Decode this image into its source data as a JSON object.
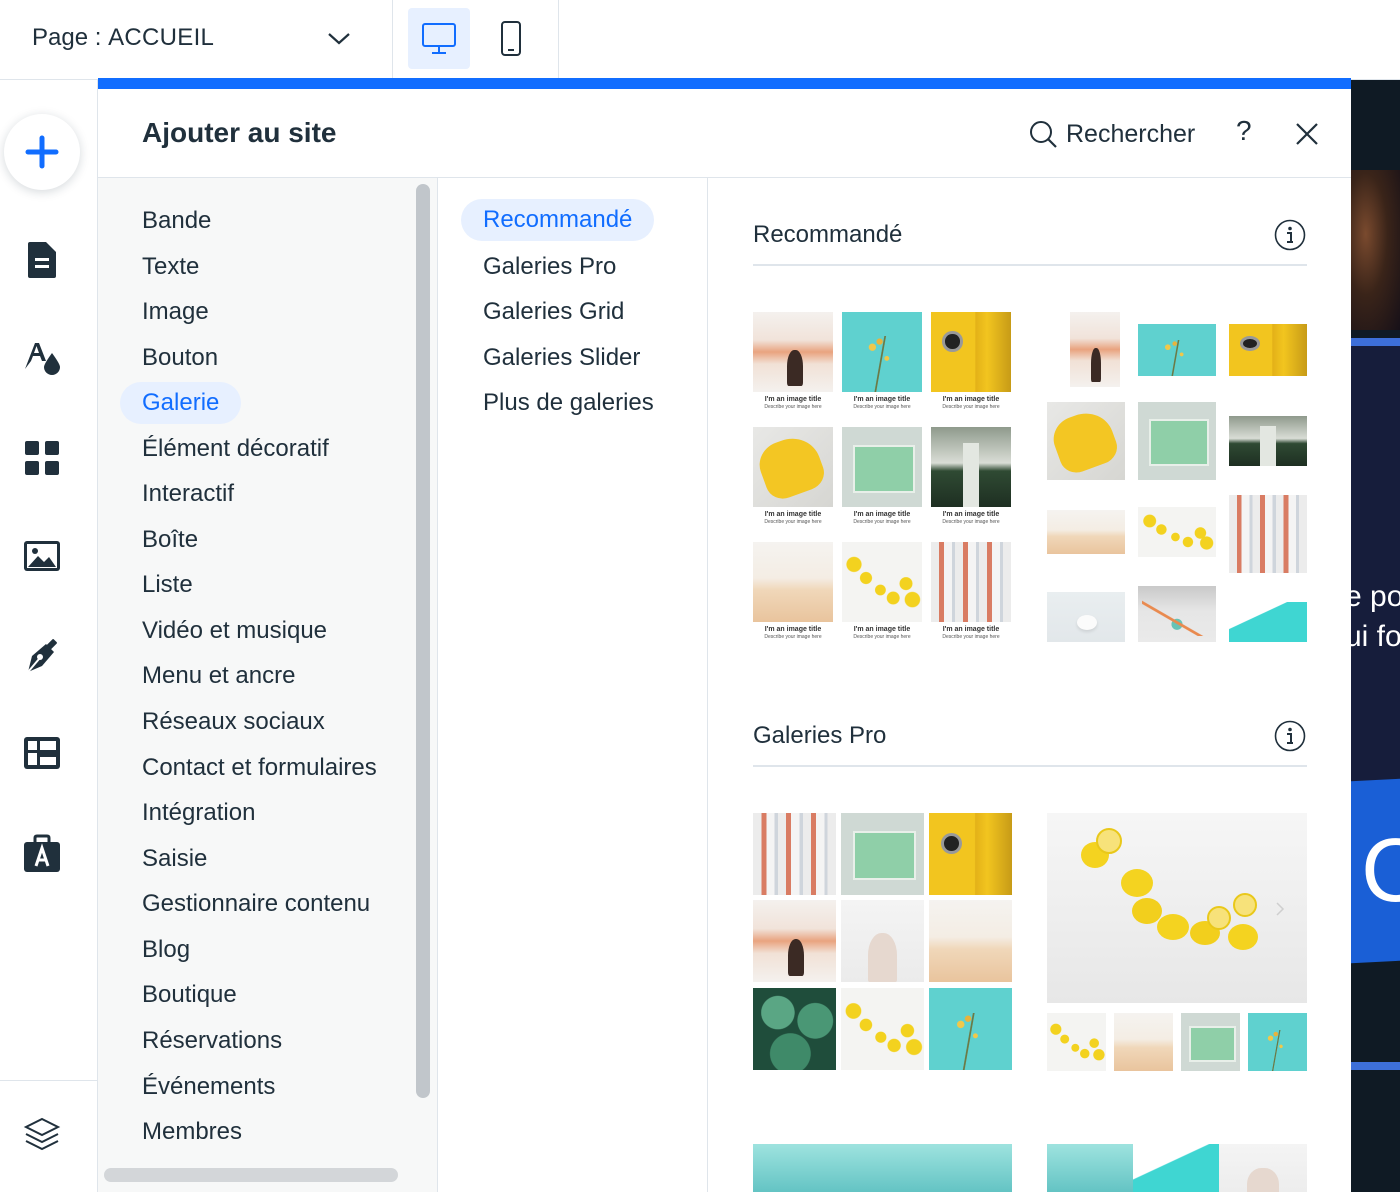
{
  "topbar": {
    "page_prefix": "Page : ",
    "page_name": "ACCUEIL"
  },
  "rail": {
    "items": [
      {
        "icon": "plus-icon"
      },
      {
        "icon": "page-icon"
      },
      {
        "icon": "design-icon"
      },
      {
        "icon": "apps-icon"
      },
      {
        "icon": "media-icon"
      },
      {
        "icon": "pen-icon"
      },
      {
        "icon": "table-icon"
      },
      {
        "icon": "portfolio-icon"
      },
      {
        "icon": "layers-icon"
      }
    ]
  },
  "canvas_strip": {
    "text_1": "e po",
    "text_2": "ui fo",
    "text_3": "C"
  },
  "panel": {
    "title": "Ajouter au site",
    "search_label": "Rechercher",
    "help_label": "?"
  },
  "categories": [
    "Bande",
    "Texte",
    "Image",
    "Bouton",
    "Galerie",
    "Élément décoratif",
    "Interactif",
    "Boîte",
    "Liste",
    "Vidéo et musique",
    "Menu et ancre",
    "Réseaux sociaux",
    "Contact et formulaires",
    "Intégration",
    "Saisie",
    "Gestionnaire contenu",
    "Blog",
    "Boutique",
    "Réservations",
    "Événements",
    "Membres"
  ],
  "selected_category": "Galerie",
  "subcategories": [
    "Recommandé",
    "Galeries Pro",
    "Galeries Grid",
    "Galeries Slider",
    "Plus de galeries"
  ],
  "selected_subcategory": "Recommandé",
  "sections": [
    {
      "title": "Recommandé"
    },
    {
      "title": "Galeries Pro"
    }
  ],
  "gallery_caption": {
    "title": "I'm an image title",
    "description": "Describe your image here"
  },
  "colors": {
    "accent": "#116dff",
    "selected_bg": "#e7f0ff",
    "text": "#20303c",
    "sidebar_bg": "#f7f8f8"
  }
}
